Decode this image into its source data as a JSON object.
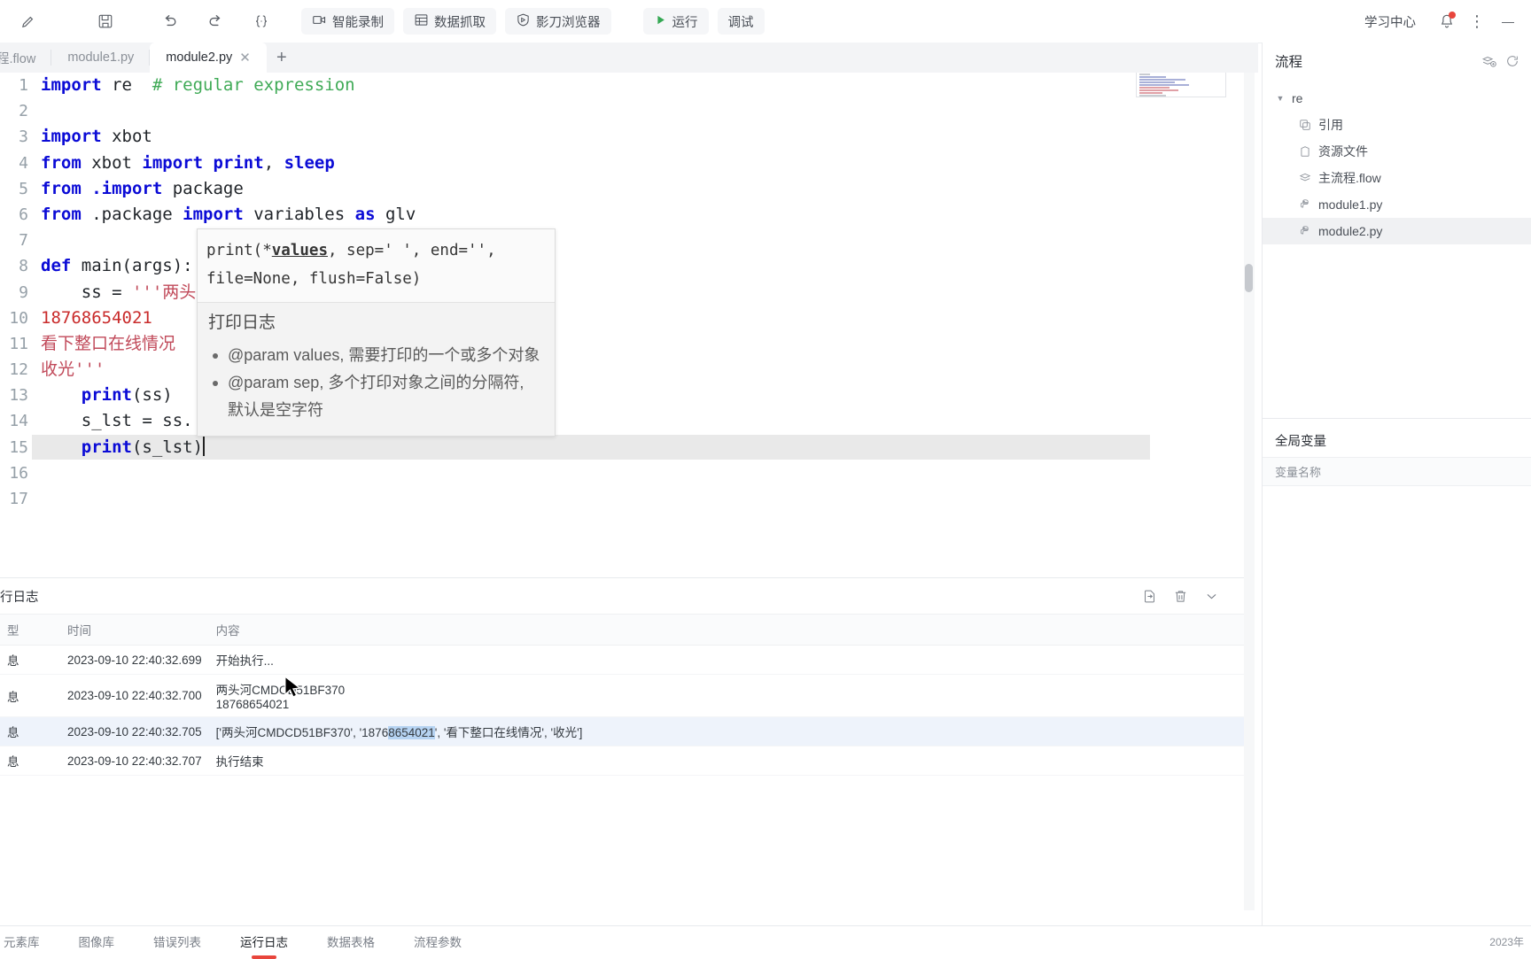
{
  "toolbar": {
    "icons": [
      {
        "name": "edit-pencil-icon",
        "glyph": "✎"
      },
      {
        "name": "save-icon",
        "glyph": "▤"
      },
      {
        "name": "undo-icon",
        "glyph": "↺"
      },
      {
        "name": "redo-icon",
        "glyph": "↻"
      },
      {
        "name": "format-code-icon",
        "glyph": "{;}"
      }
    ],
    "buttons": [
      {
        "name": "smart-record-button",
        "label": "智能录制",
        "icon": "camera-icon"
      },
      {
        "name": "data-capture-button",
        "label": "数据抓取",
        "icon": "table-icon"
      },
      {
        "name": "yingdao-browser-button",
        "label": "影刀浏览器",
        "icon": "shield-icon"
      }
    ],
    "run_label": "运行",
    "debug_label": "调试",
    "learning_center_label": "学习中心",
    "minimize_glyph": "—"
  },
  "tabs": {
    "items": [
      {
        "label": "程.flow",
        "active": false,
        "closable": false
      },
      {
        "label": "module1.py",
        "active": false,
        "closable": false
      },
      {
        "label": "module2.py",
        "active": true,
        "closable": true
      }
    ],
    "add_label": "+"
  },
  "editor": {
    "lines": [
      {
        "no": "1",
        "type": "import_re"
      },
      {
        "no": "2",
        "type": "blank"
      },
      {
        "no": "3",
        "type": "import_xbot"
      },
      {
        "no": "4",
        "type": "from_xbot"
      },
      {
        "no": "5",
        "type": "from_import_package"
      },
      {
        "no": "6",
        "type": "from_package"
      },
      {
        "no": "7",
        "type": "blank"
      },
      {
        "no": "8",
        "type": "def_main"
      },
      {
        "no": "9",
        "type": "ss_assign"
      },
      {
        "no": "10",
        "type": "phone"
      },
      {
        "no": "11",
        "type": "cn1"
      },
      {
        "no": "12",
        "type": "cn2"
      },
      {
        "no": "13",
        "type": "print_ss"
      },
      {
        "no": "14",
        "type": "s_lst"
      },
      {
        "no": "15",
        "type": "print_slst"
      },
      {
        "no": "16",
        "type": "blank"
      },
      {
        "no": "17",
        "type": "blank"
      }
    ],
    "text": {
      "l1_kw": "import",
      "l1_mod": " re",
      "l1_comment": "  # regular expression",
      "l3_kw": "import",
      "l3_mod": " xbot",
      "l4_a": "from",
      "l4_b": " xbot ",
      "l4_c": "import",
      "l4_d": " print",
      "l4_e": ", ",
      "l4_f": "sleep",
      "l5_a": "from",
      "l5_b": " .",
      "l5_c": "import",
      "l5_d": " package",
      "l6_a": "from",
      "l6_b": " .package ",
      "l6_c": "import",
      "l6_d": " variables ",
      "l6_e": "as",
      "l6_f": " glv",
      "l8_kw": "def",
      "l8_rest": " main(args):",
      "l9_a": "    ss = ",
      "l9_b": "'''",
      "l9_c": "两头",
      "l10": "18768654021",
      "l11": "看下整口在线情况",
      "l12_a": "收光",
      "l12_b": "'''",
      "l13_a": "    ",
      "l13_b": "print",
      "l13_c": "(ss)",
      "l14": "    s_lst = ss.",
      "l15_a": "    ",
      "l15_b": "print",
      "l15_c": "(s_lst)"
    }
  },
  "tooltip": {
    "signature": "print(*values, sep=' ', end='',\nfile=None, flush=False)",
    "sig_part1": "print(*",
    "sig_underline": "values",
    "sig_part2": ", sep=' ', end='',",
    "sig_line2": "file=None, flush=False)",
    "heading": "打印日志",
    "bullets": [
      "@param values, 需要打印的一个或多个对象",
      "@param sep, 多个打印对象之间的分隔符, 默认是空字符"
    ]
  },
  "right_panel": {
    "title": "流程",
    "actions": [
      {
        "name": "add-flow-icon",
        "glyph": "⧉"
      },
      {
        "name": "more-icon",
        "glyph": "⟳"
      }
    ],
    "tree": {
      "root": {
        "label": "re",
        "expanded": true,
        "icon": "chevron-down-icon"
      },
      "children": [
        {
          "label": "引用",
          "icon": "reference-icon",
          "selected": false
        },
        {
          "label": "资源文件",
          "icon": "resource-file-icon",
          "selected": false
        },
        {
          "label": "主流程.flow",
          "icon": "flow-icon",
          "selected": false
        },
        {
          "label": "module1.py",
          "icon": "python-icon",
          "selected": false
        },
        {
          "label": "module2.py",
          "icon": "python-icon",
          "selected": true
        }
      ]
    },
    "global_vars": {
      "title": "全局变量",
      "column": "变量名称"
    }
  },
  "log_panel": {
    "title": "行日志",
    "actions": [
      {
        "name": "export-log-icon",
        "glyph": "⇥"
      },
      {
        "name": "clear-log-icon",
        "glyph": "🗑"
      },
      {
        "name": "collapse-panel-icon",
        "glyph": "⌄"
      }
    ],
    "columns": [
      "型",
      "时间",
      "内容"
    ],
    "rows": [
      {
        "type": "息",
        "time": "2023-09-10 22:40:32.699",
        "content": "开始执行...",
        "selected": false
      },
      {
        "type": "息",
        "time": "2023-09-10 22:40:32.700",
        "content": "两头河CMDCD51BF370",
        "selected": false
      },
      {
        "type": "息",
        "time": "2023-09-10 22:40:32.705",
        "content_pre": "['两头河CMDCD51BF37",
        "content_mid": "0', '1876",
        "content_hl": "8654021",
        "content_post": "', '看下整口在线情况', '收光']",
        "selected": true
      },
      {
        "type": "息",
        "time": "2023-09-10 22:40:32.707",
        "content": "执行结束",
        "selected": false
      }
    ],
    "row2_overflow": "18768654021"
  },
  "bottom_tabs": {
    "items": [
      {
        "label": "元素库",
        "active": false
      },
      {
        "label": "图像库",
        "active": false
      },
      {
        "label": "错误列表",
        "active": false
      },
      {
        "label": "运行日志",
        "active": true
      },
      {
        "label": "数据表格",
        "active": false
      },
      {
        "label": "流程参数",
        "active": false
      }
    ],
    "status_right": "2023年"
  },
  "colors": {
    "accent_red": "#e8453c",
    "run_green": "#34a853",
    "keyword_blue": "#0b0bd6",
    "comment_green": "#3faa56",
    "string_red": "#c14a5a",
    "selection_blue": "#b6d3f2"
  }
}
